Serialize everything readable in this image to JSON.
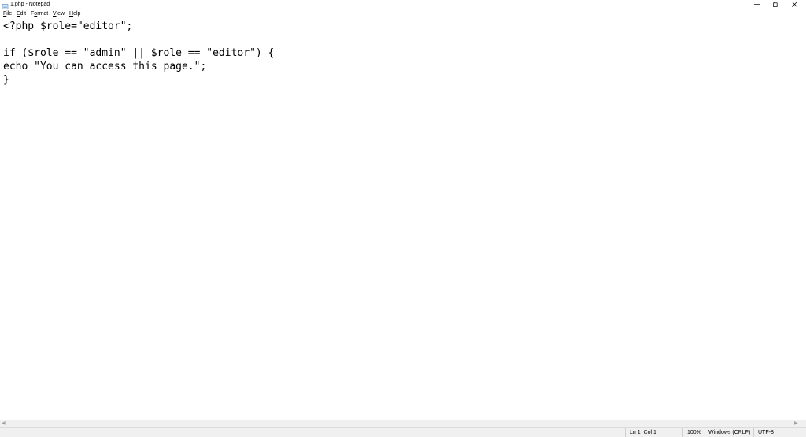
{
  "window": {
    "title": "1.php - Notepad"
  },
  "menu": {
    "file": {
      "mnemonic": "F",
      "rest": "ile"
    },
    "edit": {
      "mnemonic": "E",
      "rest": "dit"
    },
    "format": {
      "pre": "F",
      "mnemonic": "o",
      "rest": "rmat"
    },
    "view": {
      "mnemonic": "V",
      "rest": "iew"
    },
    "help": {
      "mnemonic": "H",
      "rest": "elp"
    }
  },
  "editor": {
    "content": "<?php $role=\"editor\";\n\nif ($role == \"admin\" || $role == \"editor\") {\necho \"You can access this page.\";\n}"
  },
  "status": {
    "position": "Ln 1, Col 1",
    "zoom": "100%",
    "line_ending": "Windows (CRLF)",
    "encoding": "UTF-8"
  },
  "icons": {
    "app": "notepad-icon",
    "minimize": "minimize-icon",
    "maximize": "restore-icon",
    "close": "close-icon"
  }
}
